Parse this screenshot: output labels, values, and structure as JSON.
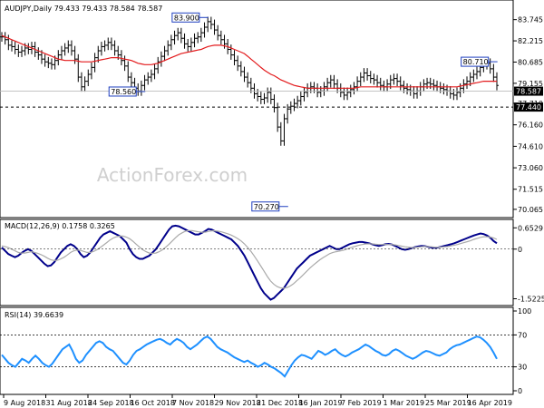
{
  "chart_data": [
    {
      "type": "line",
      "subtype": "ohlc-bars",
      "panel": "price",
      "title": "AUDJPY,Daily  79.433 79.433 78.584 78.587",
      "watermark": "ActionForex.com",
      "yticks": [
        70.065,
        71.515,
        73.06,
        74.61,
        76.16,
        77.71,
        79.155,
        80.685,
        82.215,
        83.745
      ],
      "ylim": [
        69.6,
        84.9
      ],
      "current_price": "78.587",
      "support_level": "77.440",
      "annotations": [
        "83.900",
        "78.560",
        "80.710",
        "70.270"
      ],
      "series": [
        {
          "name": "",
          "color": "#000000",
          "values": [
            82.5,
            82.3,
            81.9,
            81.8,
            81.6,
            81.4,
            81.5,
            81.7,
            81.6,
            81.8,
            81.4,
            81.2,
            80.9,
            80.7,
            80.6,
            80.5,
            80.8,
            81.2,
            81.5,
            81.7,
            81.9,
            81.5,
            80.9,
            79.6,
            78.9,
            79.3,
            79.8,
            80.3,
            81.0,
            81.5,
            81.8,
            81.9,
            82.1,
            81.9,
            81.5,
            81.2,
            80.8,
            80.4,
            79.6,
            79.2,
            78.8,
            78.6,
            79.0,
            79.4,
            79.6,
            79.8,
            80.2,
            80.7,
            81.1,
            81.5,
            81.9,
            82.3,
            82.6,
            82.8,
            82.4,
            82.0,
            81.8,
            82.1,
            82.4,
            82.5,
            82.8,
            83.2,
            83.6,
            83.4,
            83.0,
            82.6,
            82.3,
            82.0,
            81.6,
            81.2,
            80.8,
            80.4,
            80.0,
            79.6,
            79.2,
            78.8,
            78.4,
            78.2,
            78.0,
            78.1,
            78.5,
            78.0,
            77.4,
            76.0,
            75.0,
            76.6,
            77.3,
            77.5,
            77.7,
            77.9,
            78.2,
            78.5,
            78.8,
            78.9,
            78.8,
            78.5,
            78.6,
            78.9,
            79.2,
            79.4,
            79.1,
            78.8,
            78.5,
            78.3,
            78.5,
            78.7,
            78.9,
            79.3,
            79.6,
            79.9,
            79.7,
            79.5,
            79.4,
            79.2,
            79.0,
            78.9,
            79.1,
            79.4,
            79.5,
            79.3,
            79.0,
            78.8,
            78.7,
            78.6,
            78.4,
            78.6,
            78.9,
            79.1,
            79.2,
            79.1,
            79.0,
            78.9,
            78.8,
            78.7,
            78.6,
            78.4,
            78.3,
            78.5,
            78.8,
            79.1,
            79.3,
            79.6,
            79.8,
            80.0,
            80.3,
            80.5,
            80.6,
            80.2,
            79.6,
            79.0
          ]
        },
        {
          "name": "",
          "color": "#e31a1c",
          "values": [
            82.6,
            82.5,
            82.4,
            82.3,
            82.2,
            82.1,
            82.0,
            81.9,
            81.8,
            81.7,
            81.6,
            81.5,
            81.4,
            81.3,
            81.2,
            81.1,
            81.0,
            80.9,
            80.85,
            80.8,
            80.8,
            80.8,
            80.8,
            80.75,
            80.7,
            80.7,
            80.7,
            80.7,
            80.75,
            80.8,
            80.85,
            80.9,
            80.95,
            81.0,
            81.0,
            81.0,
            80.95,
            80.9,
            80.85,
            80.8,
            80.7,
            80.6,
            80.55,
            80.5,
            80.5,
            80.5,
            80.55,
            80.6,
            80.7,
            80.8,
            80.9,
            81.0,
            81.1,
            81.2,
            81.3,
            81.35,
            81.4,
            81.45,
            81.5,
            81.55,
            81.6,
            81.7,
            81.8,
            81.85,
            81.9,
            81.9,
            81.9,
            81.85,
            81.8,
            81.7,
            81.6,
            81.5,
            81.4,
            81.3,
            81.1,
            80.9,
            80.7,
            80.5,
            80.3,
            80.1,
            79.95,
            79.8,
            79.7,
            79.55,
            79.4,
            79.3,
            79.2,
            79.1,
            79.0,
            78.95,
            78.9,
            78.85,
            78.8,
            78.8,
            78.8,
            78.8,
            78.8,
            78.8,
            78.8,
            78.8,
            78.8,
            78.8,
            78.8,
            78.8,
            78.8,
            78.8,
            78.8,
            78.85,
            78.9,
            78.9,
            78.9,
            78.9,
            78.9,
            78.9,
            78.9,
            78.9,
            78.9,
            78.9,
            78.9,
            78.9,
            78.9,
            78.9,
            78.9,
            78.9,
            78.9,
            78.9,
            78.9,
            78.9,
            78.9,
            78.9,
            78.9,
            78.9,
            78.9,
            78.9,
            78.9,
            78.9,
            78.9,
            78.9,
            78.95,
            79.0,
            79.05,
            79.1,
            79.15,
            79.2,
            79.25,
            79.3,
            79.3,
            79.3,
            79.3,
            79.3
          ]
        }
      ]
    },
    {
      "type": "line",
      "panel": "macd",
      "title": "MACD(12,26,9) 0.1758 0.3265",
      "yticks": [
        0.6529,
        0,
        -1.5225
      ],
      "ylim": [
        -1.62,
        0.8
      ],
      "series": [
        {
          "name": "",
          "color": "#00008b",
          "values": [
            0.05,
            -0.05,
            -0.15,
            -0.2,
            -0.25,
            -0.2,
            -0.12,
            -0.05,
            0.0,
            -0.05,
            -0.15,
            -0.25,
            -0.35,
            -0.45,
            -0.52,
            -0.5,
            -0.4,
            -0.25,
            -0.1,
            0.0,
            0.1,
            0.15,
            0.1,
            0.0,
            -0.15,
            -0.25,
            -0.2,
            -0.1,
            0.05,
            0.2,
            0.35,
            0.45,
            0.5,
            0.55,
            0.5,
            0.45,
            0.4,
            0.3,
            0.2,
            0.0,
            -0.15,
            -0.25,
            -0.3,
            -0.3,
            -0.25,
            -0.2,
            -0.1,
            0.0,
            0.15,
            0.3,
            0.45,
            0.6,
            0.7,
            0.72,
            0.7,
            0.65,
            0.6,
            0.55,
            0.5,
            0.45,
            0.45,
            0.5,
            0.55,
            0.62,
            0.6,
            0.55,
            0.5,
            0.45,
            0.4,
            0.35,
            0.3,
            0.2,
            0.1,
            -0.05,
            -0.2,
            -0.4,
            -0.6,
            -0.8,
            -1.0,
            -1.2,
            -1.35,
            -1.45,
            -1.55,
            -1.5,
            -1.4,
            -1.3,
            -1.2,
            -1.05,
            -0.9,
            -0.75,
            -0.6,
            -0.5,
            -0.4,
            -0.3,
            -0.2,
            -0.15,
            -0.1,
            -0.05,
            0.0,
            0.05,
            0.1,
            0.05,
            0.0,
            0.0,
            0.05,
            0.1,
            0.15,
            0.18,
            0.2,
            0.22,
            0.22,
            0.2,
            0.18,
            0.15,
            0.12,
            0.1,
            0.12,
            0.15,
            0.16,
            0.14,
            0.1,
            0.05,
            0.0,
            -0.02,
            0.0,
            0.03,
            0.06,
            0.08,
            0.1,
            0.09,
            0.07,
            0.05,
            0.04,
            0.05,
            0.07,
            0.1,
            0.12,
            0.15,
            0.18,
            0.22,
            0.26,
            0.3,
            0.34,
            0.38,
            0.42,
            0.45,
            0.48,
            0.46,
            0.42,
            0.35,
            0.25,
            0.18
          ]
        },
        {
          "name": "",
          "color": "#aaaaaa",
          "values": [
            0.1,
            0.08,
            0.05,
            0.0,
            -0.05,
            -0.1,
            -0.12,
            -0.12,
            -0.1,
            -0.08,
            -0.1,
            -0.13,
            -0.17,
            -0.22,
            -0.28,
            -0.33,
            -0.35,
            -0.34,
            -0.3,
            -0.25,
            -0.18,
            -0.1,
            -0.05,
            -0.03,
            -0.04,
            -0.07,
            -0.1,
            -0.1,
            -0.07,
            -0.02,
            0.05,
            0.12,
            0.2,
            0.28,
            0.34,
            0.38,
            0.4,
            0.4,
            0.37,
            0.32,
            0.24,
            0.15,
            0.06,
            -0.02,
            -0.08,
            -0.12,
            -0.13,
            -0.12,
            -0.08,
            -0.02,
            0.06,
            0.15,
            0.25,
            0.35,
            0.44,
            0.5,
            0.55,
            0.57,
            0.57,
            0.55,
            0.53,
            0.52,
            0.52,
            0.54,
            0.56,
            0.56,
            0.55,
            0.53,
            0.5,
            0.47,
            0.43,
            0.38,
            0.32,
            0.25,
            0.16,
            0.05,
            -0.07,
            -0.21,
            -0.36,
            -0.52,
            -0.68,
            -0.84,
            -0.98,
            -1.08,
            -1.15,
            -1.19,
            -1.2,
            -1.18,
            -1.13,
            -1.06,
            -0.97,
            -0.88,
            -0.78,
            -0.68,
            -0.58,
            -0.49,
            -0.41,
            -0.33,
            -0.26,
            -0.2,
            -0.14,
            -0.1,
            -0.08,
            -0.06,
            -0.04,
            -0.01,
            0.03,
            0.06,
            0.09,
            0.12,
            0.14,
            0.16,
            0.16,
            0.16,
            0.15,
            0.14,
            0.14,
            0.14,
            0.14,
            0.14,
            0.13,
            0.11,
            0.09,
            0.07,
            0.06,
            0.05,
            0.05,
            0.06,
            0.07,
            0.08,
            0.08,
            0.07,
            0.06,
            0.06,
            0.06,
            0.07,
            0.08,
            0.1,
            0.12,
            0.14,
            0.17,
            0.2,
            0.23,
            0.26,
            0.3,
            0.33,
            0.36,
            0.38,
            0.38,
            0.37,
            0.34,
            0.3
          ]
        }
      ]
    },
    {
      "type": "line",
      "panel": "rsi",
      "title": "RSI(14) 39.6639",
      "yticks": [
        100,
        70,
        30,
        0
      ],
      "ylim": [
        0,
        100
      ],
      "reference_lines": [
        70,
        30
      ],
      "series": [
        {
          "name": "",
          "color": "#1e90ff",
          "values": [
            45,
            40,
            35,
            32,
            30,
            35,
            40,
            38,
            35,
            40,
            44,
            40,
            35,
            32,
            30,
            34,
            40,
            46,
            52,
            55,
            58,
            50,
            40,
            35,
            38,
            45,
            50,
            55,
            60,
            62,
            60,
            55,
            52,
            50,
            45,
            40,
            35,
            33,
            38,
            45,
            50,
            52,
            55,
            58,
            60,
            62,
            64,
            65,
            63,
            60,
            58,
            62,
            65,
            63,
            60,
            55,
            52,
            55,
            58,
            62,
            66,
            68,
            65,
            60,
            55,
            52,
            50,
            48,
            45,
            42,
            40,
            38,
            36,
            38,
            35,
            33,
            30,
            32,
            35,
            33,
            30,
            28,
            25,
            22,
            18,
            25,
            32,
            38,
            42,
            45,
            44,
            42,
            40,
            45,
            50,
            48,
            45,
            47,
            50,
            52,
            48,
            45,
            43,
            45,
            48,
            50,
            52,
            55,
            58,
            56,
            53,
            50,
            48,
            45,
            44,
            46,
            50,
            52,
            50,
            47,
            44,
            42,
            40,
            42,
            45,
            48,
            50,
            49,
            47,
            45,
            44,
            46,
            48,
            52,
            55,
            57,
            58,
            60,
            62,
            64,
            66,
            68,
            67,
            64,
            60,
            55,
            48,
            40
          ]
        }
      ]
    }
  ],
  "x_axis_labels": [
    "9 Aug 2018",
    "31 Aug 2018",
    "24 Sep 2018",
    "16 Oct 2018",
    "7 Nov 2018",
    "29 Nov 2018",
    "21 Dec 2018",
    "16 Jan 2019",
    "7 Feb 2019",
    "1 Mar 2019",
    "25 Mar 2019",
    "16 Apr 2019"
  ]
}
